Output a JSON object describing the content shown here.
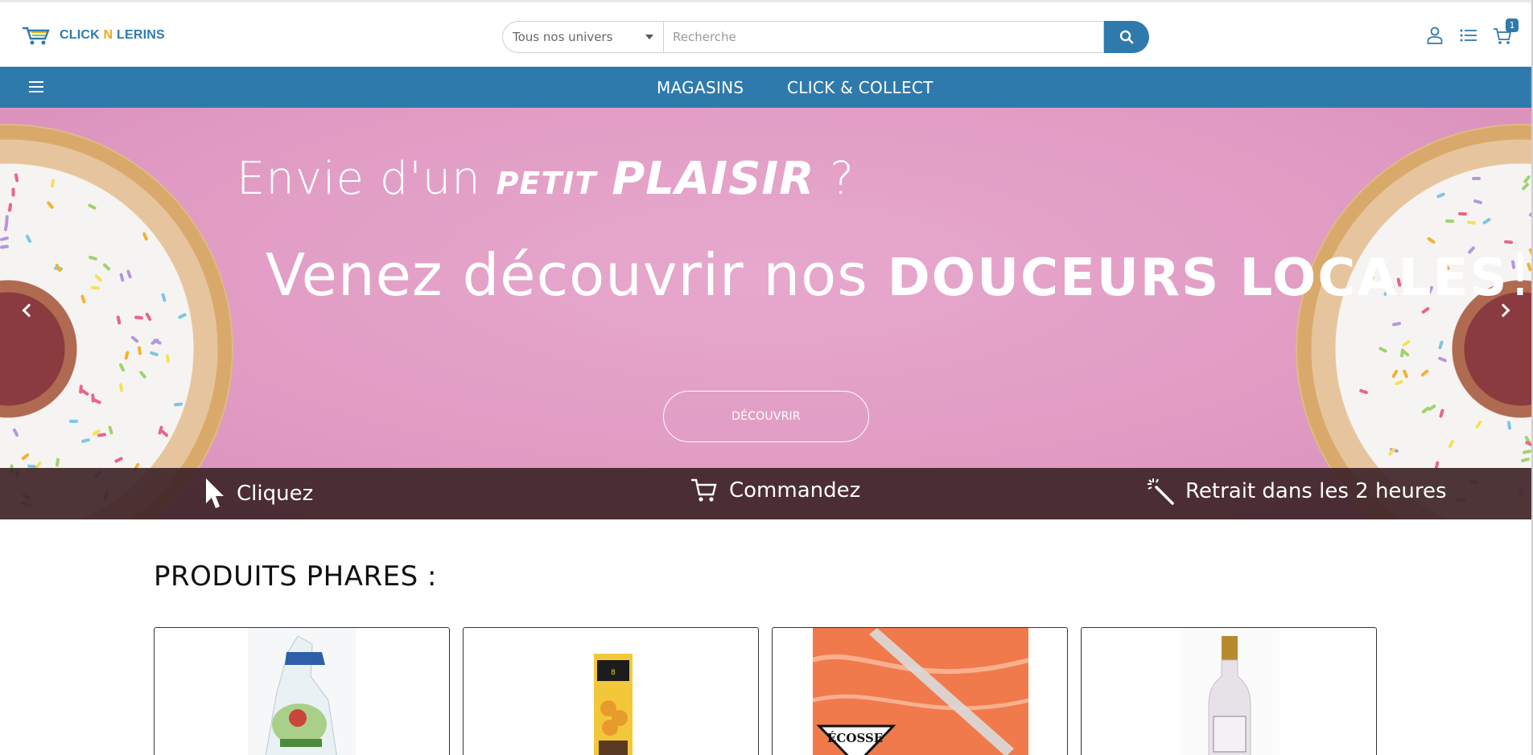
{
  "brand": {
    "name_part1": "CLICK",
    "name_part2": "N",
    "name_part3": "LERINS"
  },
  "search": {
    "category_selected": "Tous nos univers",
    "placeholder": "Recherche"
  },
  "header": {
    "cart_count": "1"
  },
  "nav": {
    "items": [
      "MAGASINS",
      "CLICK & COLLECT"
    ]
  },
  "hero": {
    "line1_prefix": "Envie d'un",
    "line1_em1": "PETIT",
    "line1_em2": "PLAISIR",
    "line1_suffix": "?",
    "line2_prefix": "Venez découvrir nos",
    "line2_em": "DOUCEURS LOCALES",
    "line2_suffix": "!",
    "button": "DÉCOUVRIR"
  },
  "steps": [
    "Cliquez",
    "Commandez",
    "Retrait dans les 2 heures"
  ],
  "products": {
    "title": "PRODUITS PHARES :",
    "items": [
      {
        "image": "bag-product"
      },
      {
        "image": "biscuit-pack"
      },
      {
        "image": "salmon-slice",
        "label": "ÉCOSSE"
      },
      {
        "image": "sparkling-bottle"
      }
    ]
  },
  "colors": {
    "brand_blue": "#2f7aad",
    "accent_orange": "#f2a71b",
    "hero_pink": "#e19cc4",
    "steps_bar": "#3e2428"
  }
}
